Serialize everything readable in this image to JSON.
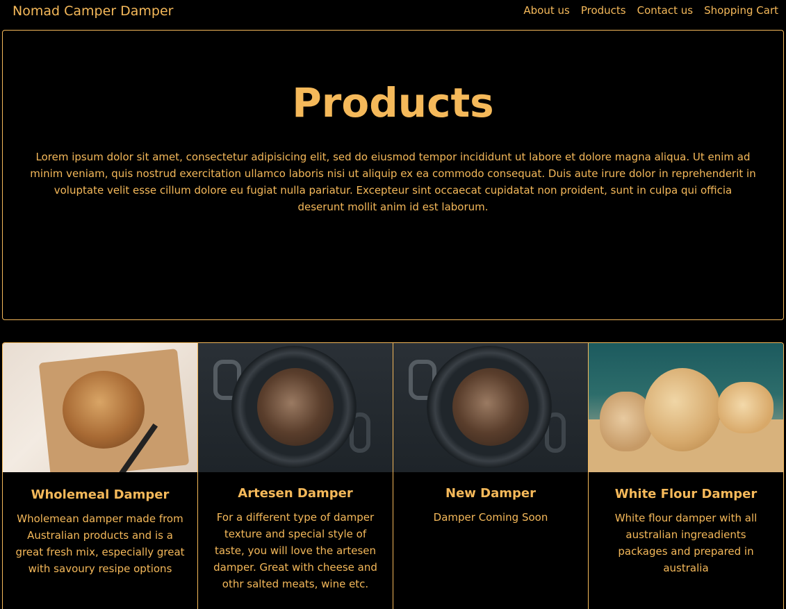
{
  "nav": {
    "brand": "Nomad Camper Damper",
    "links": [
      "About us",
      "Products",
      "Contact us",
      "Shopping Cart"
    ]
  },
  "hero": {
    "title": "Products",
    "text": "Lorem ipsum dolor sit amet, consectetur adipisicing elit, sed do eiusmod tempor incididunt ut labore et dolore magna aliqua. Ut enim ad minim veniam, quis nostrud exercitation ullamco laboris nisi ut aliquip ex ea commodo consequat. Duis aute irure dolor in reprehenderit in voluptate velit esse cillum dolore eu fugiat nulla pariatur. Excepteur sint occaecat cupidatat non proident, sunt in culpa qui officia deserunt mollit anim id est laborum."
  },
  "products": [
    {
      "title": "Wholemeal Damper",
      "text": "Wholemean damper made from Australian products and is a great fresh mix, especially great with savoury resipe options",
      "image": "bread-loaf-on-board-image"
    },
    {
      "title": "Artesen Damper",
      "text": "For a different type of damper texture and special style of taste, you will love the artesen damper. Great with cheese and othr salted meats, wine etc.",
      "image": "bread-in-pot-image"
    },
    {
      "title": "New Damper",
      "text": "Damper Coming Soon",
      "image": "bread-in-pot-image"
    },
    {
      "title": "White Flour Damper",
      "text": "White flour damper with all australian ingreadients packages and prepared in australia",
      "image": "sliced-bread-image"
    }
  ],
  "colors": {
    "accent": "#f5b95a",
    "background": "#000000"
  }
}
